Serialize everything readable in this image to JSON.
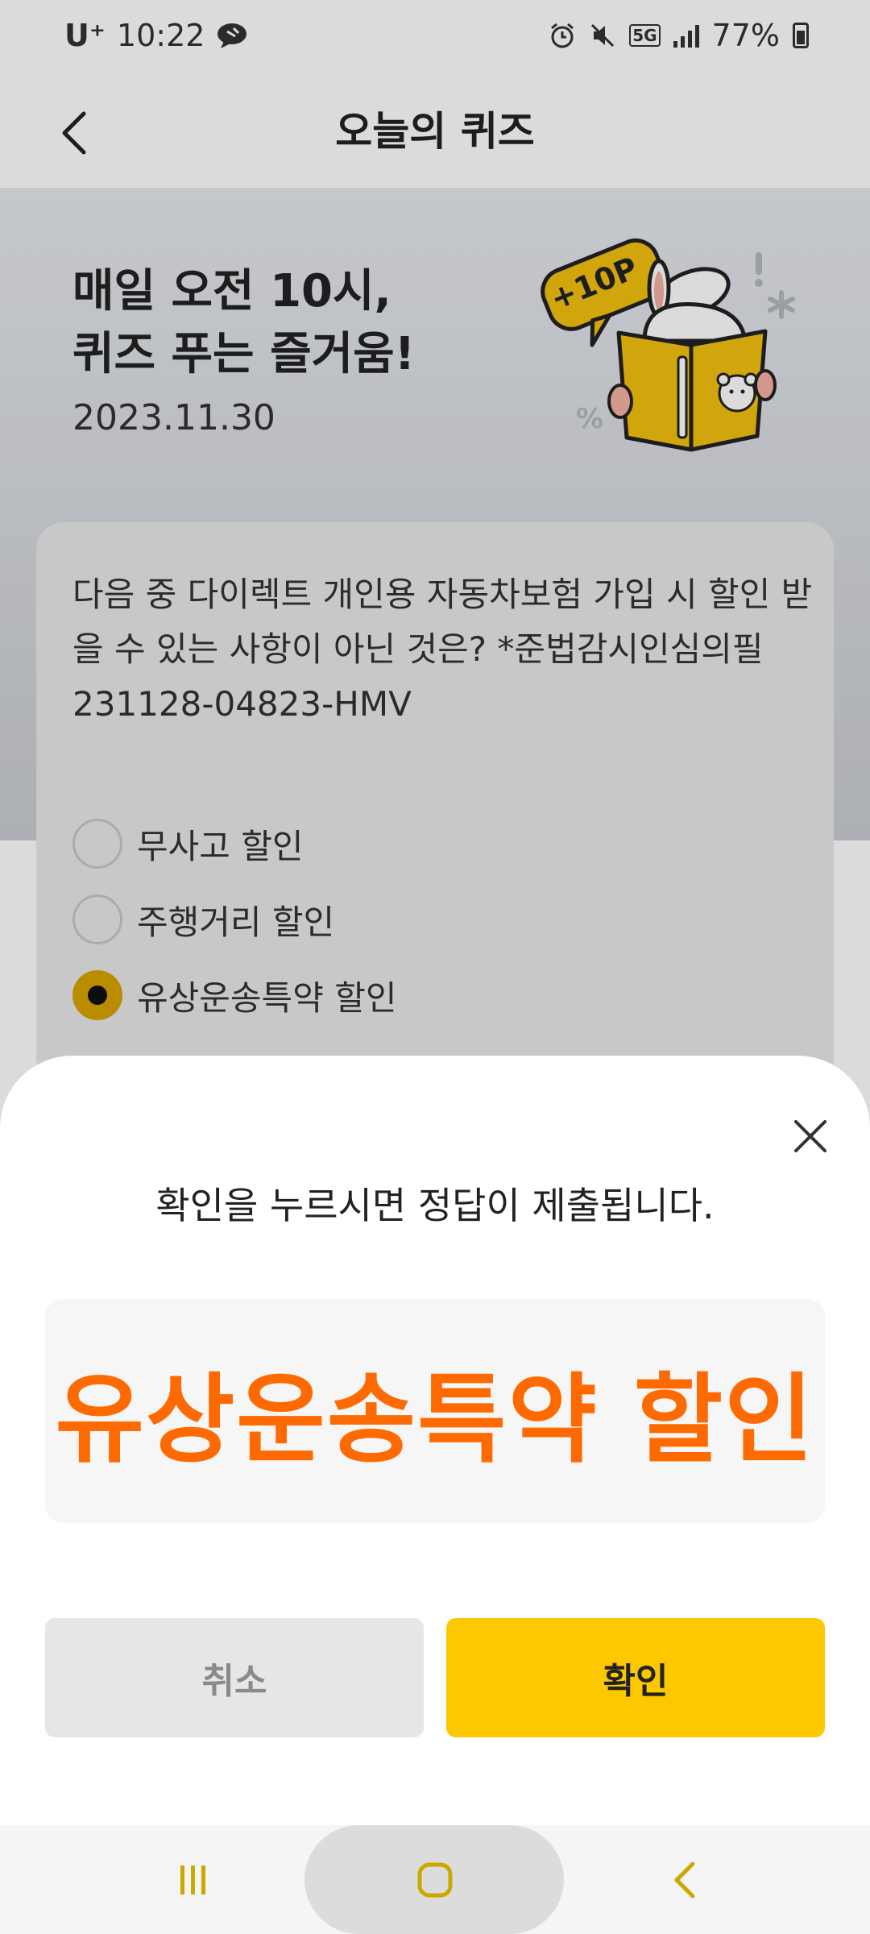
{
  "status_bar": {
    "carrier": "U⁺",
    "time": "10:22",
    "network": "5G",
    "battery": "77%"
  },
  "header": {
    "title": "오늘의 퀴즈"
  },
  "hero": {
    "title_line1": "매일 오전 10시,",
    "title_line2": "퀴즈 푸는 즐거움!",
    "date": "2023.11.30",
    "badge": "+10P"
  },
  "quiz": {
    "question": "다음 중 다이렉트 개인용 자동차보험 가입 시 할인 받을 수 있는 사항이 아닌 것은? *준법감시인심의필 231128-04823-HMV",
    "options": [
      {
        "label": "무사고 할인",
        "selected": false
      },
      {
        "label": "주행거리 할인",
        "selected": false
      },
      {
        "label": "유상운송특약 할인",
        "selected": true
      }
    ]
  },
  "sheet": {
    "message": "확인을 누르시면 정답이 제출됩니다.",
    "answer": "유상운송특약 할인",
    "cancel_label": "취소",
    "confirm_label": "확인"
  },
  "colors": {
    "accent": "#fdc800",
    "answer": "#ff6a00",
    "nav_icon": "#c9a800"
  }
}
